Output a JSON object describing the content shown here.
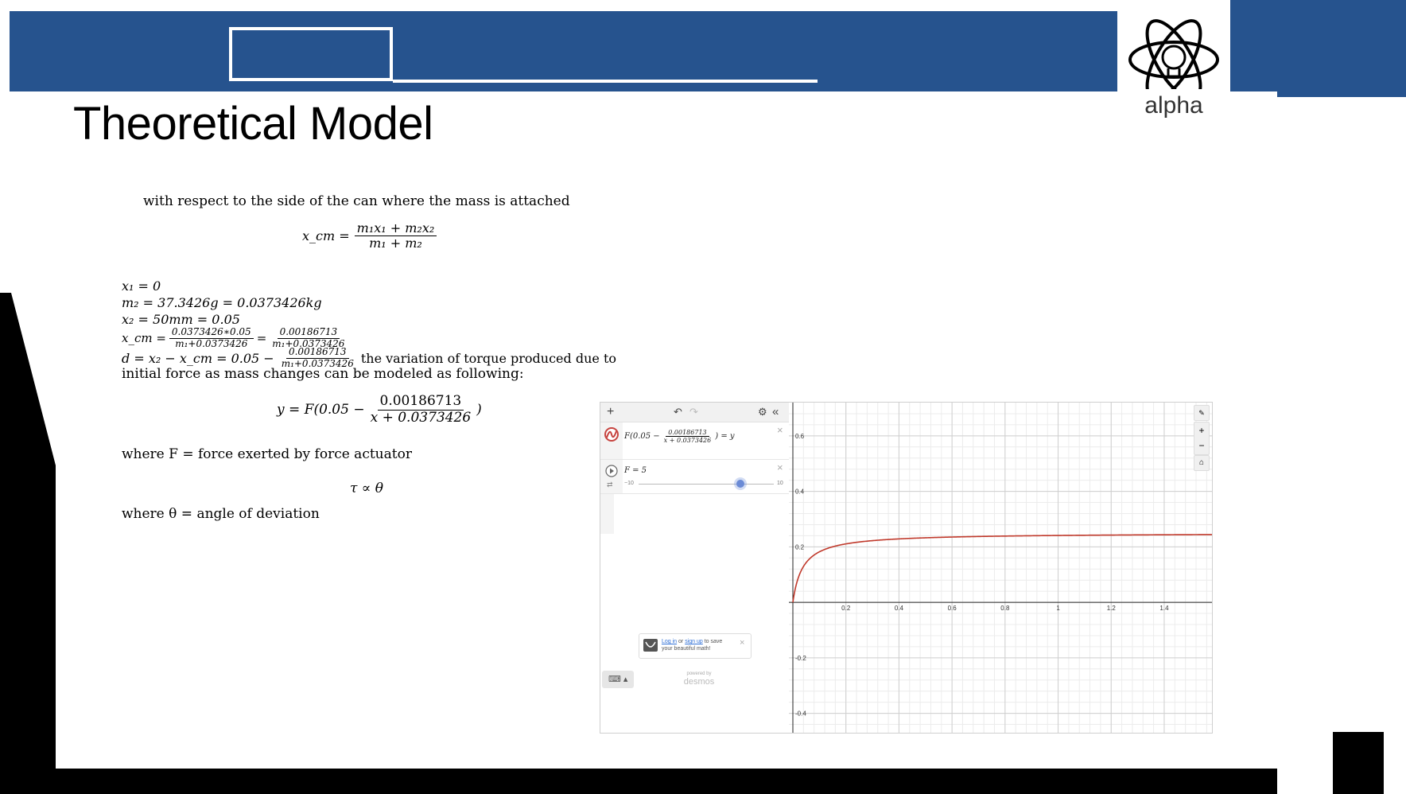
{
  "slide": {
    "title": "Theoretical Model",
    "logo_text": "alpha",
    "colors": {
      "band": "#26538e",
      "black": "#000000",
      "curve": "#c0392b"
    }
  },
  "model": {
    "intro": "with respect to the side of the can where the mass is attached",
    "xcm_lhs": "x_cm =",
    "xcm_num": "m₁x₁ + m₂x₂",
    "xcm_den": "m₁ + m₂",
    "eq_x1": "x₁ = 0",
    "eq_m2": "m₂ = 37.3426g = 0.0373426kg",
    "eq_x2": "x₂ = 50mm = 0.05",
    "eq_xcm_lhs": "x_cm =",
    "eq_xcm_frac1_num": "0.0373426∗0.05",
    "eq_xcm_frac1_den": "m₁+0.0373426",
    "eq_xcm_eq": "=",
    "eq_xcm_frac2_num": "0.00186713",
    "eq_xcm_frac2_den": "m₁+0.0373426",
    "eq_d_lhs": "d = x₂ − x_cm = 0.05 −",
    "eq_d_frac_num": "0.00186713",
    "eq_d_frac_den": "m₁+0.0373426",
    "eq_d_tail": "the variation of torque produced due to",
    "line_initial": "initial force as mass changes can be modeled as following:",
    "y_lhs": "y = F(0.05 −",
    "y_num": "0.00186713",
    "y_den": "x + 0.0373426",
    "y_close": ")",
    "where_f": "where F = force exerted by force actuator",
    "tau": "τ ∝ θ",
    "where_theta": "where θ = angle of deviation"
  },
  "desmos": {
    "toolbar": {
      "add": "+",
      "undo": "↶",
      "redo": "↷",
      "settings": "⚙",
      "collapse": "«"
    },
    "expr1": {
      "lhs": "F(0.05 −",
      "num": "0.00186713",
      "den": "x + 0.0373426",
      "rhs": ") = y"
    },
    "expr2": {
      "label": "F = 5",
      "slider_min": "−10",
      "slider_max": "10",
      "slider_value": 5
    },
    "login": {
      "link1": "Log in",
      "mid": " or ",
      "link2": "sign up",
      "tail": " to save",
      "line2": "your beautiful math!"
    },
    "powered_by": "powered by",
    "brand": "desmos",
    "graph_controls": {
      "wrench": "🔧",
      "zoom_in": "+",
      "zoom_out": "−",
      "home": "⌂"
    }
  },
  "chart_data": {
    "type": "line",
    "function": "y = 5(0.05 − 0.00186713/(x + 0.0373426))",
    "F": 5,
    "xlim": [
      -0.015,
      1.58
    ],
    "ylim": [
      -0.47,
      0.72
    ],
    "x_ticks": [
      "0.2",
      "0.4",
      "0.6",
      "0.8",
      "1",
      "1.2",
      "1.4"
    ],
    "y_ticks": [
      "0.6",
      "0.4",
      "0.2",
      "-0.2",
      "-0.4"
    ],
    "grid": true
  }
}
